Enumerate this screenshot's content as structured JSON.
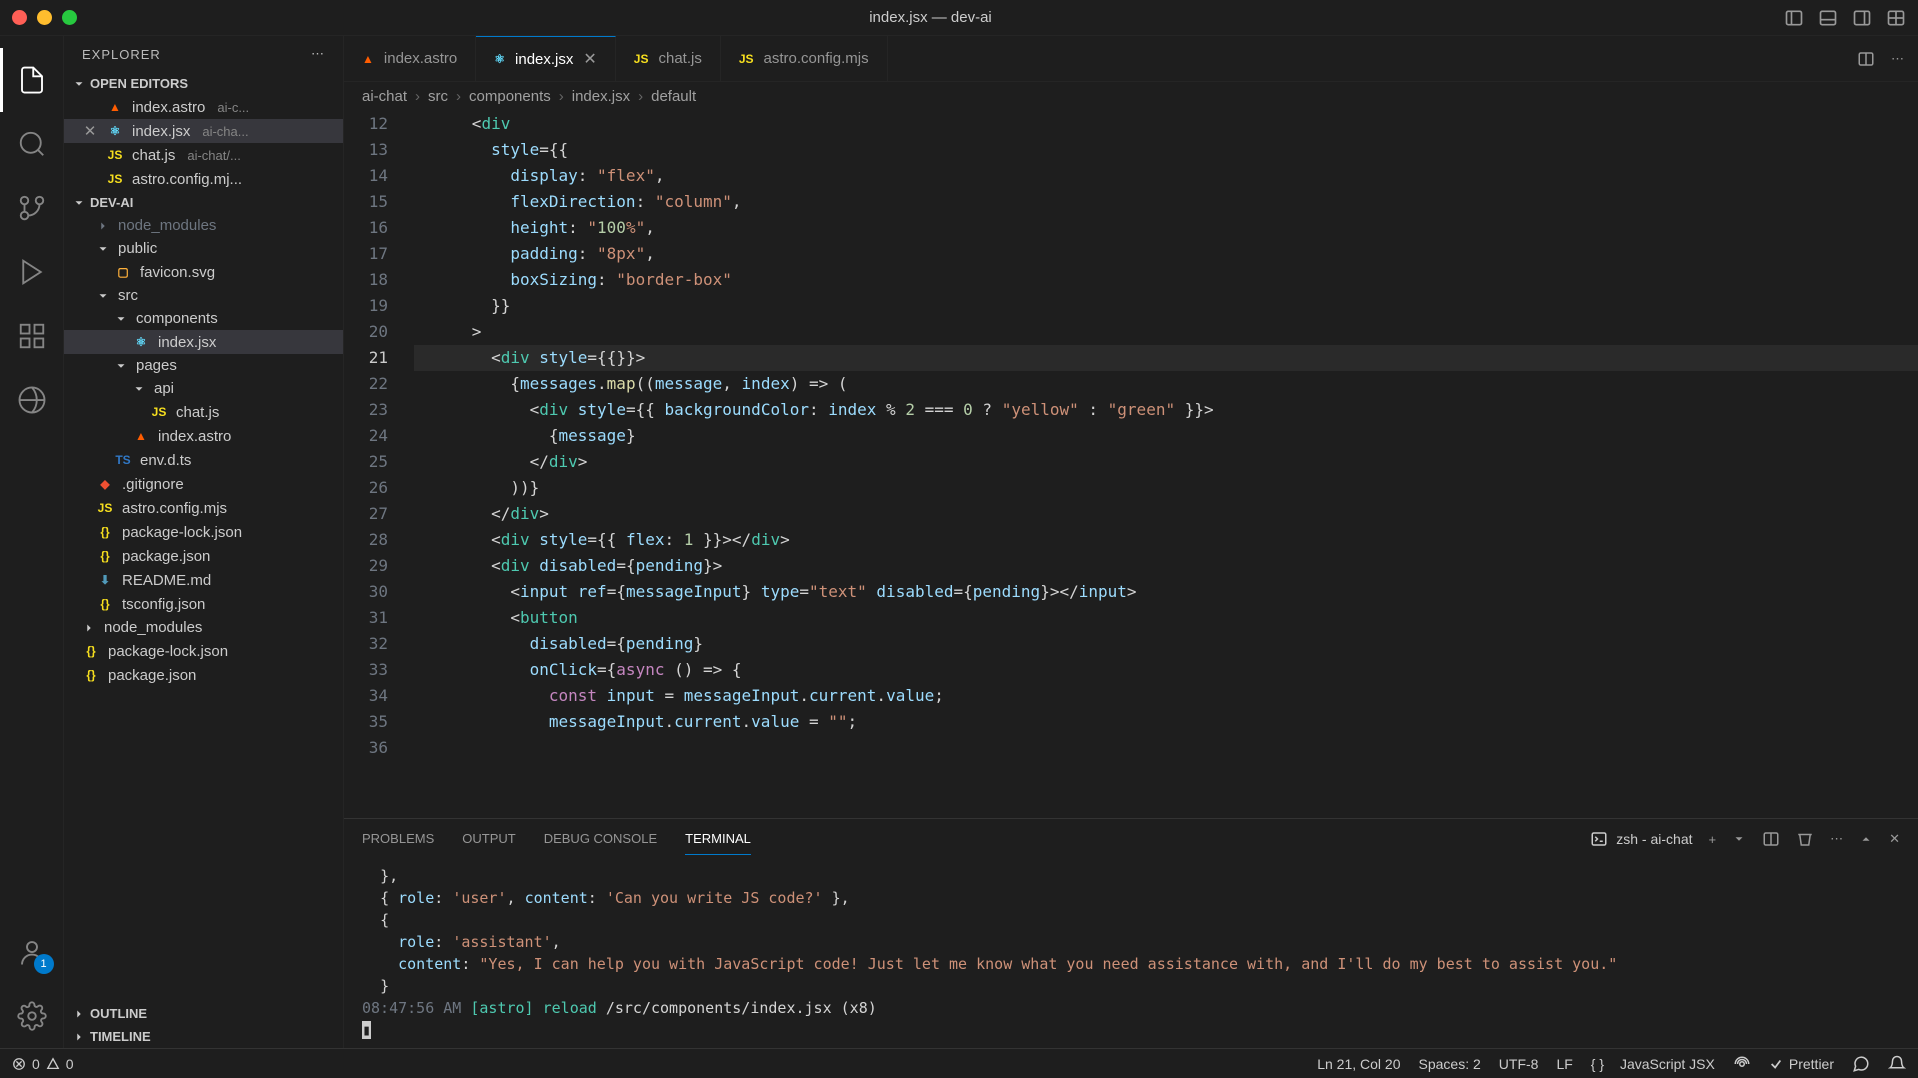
{
  "titlebar": {
    "title": "index.jsx — dev-ai"
  },
  "sidebar": {
    "title": "EXPLORER",
    "sections": {
      "openEditors": "OPEN EDITORS",
      "project": "DEV-AI",
      "outline": "OUTLINE",
      "timeline": "TIMELINE"
    },
    "openEditors": [
      {
        "name": "index.astro",
        "meta": "ai-c...",
        "close": false
      },
      {
        "name": "index.jsx",
        "meta": "ai-cha...",
        "close": true,
        "selected": true
      },
      {
        "name": "chat.js",
        "meta": "ai-chat/...",
        "close": false
      },
      {
        "name": "astro.config.mj...",
        "meta": "",
        "close": false
      }
    ],
    "tree": [
      {
        "label": "node_modules",
        "indent": 1,
        "type": "folder-dim"
      },
      {
        "label": "public",
        "indent": 1,
        "type": "folder-open"
      },
      {
        "label": "favicon.svg",
        "indent": 2,
        "type": "svg"
      },
      {
        "label": "src",
        "indent": 1,
        "type": "folder-open"
      },
      {
        "label": "components",
        "indent": 2,
        "type": "folder-open"
      },
      {
        "label": "index.jsx",
        "indent": 3,
        "type": "react",
        "selected": true
      },
      {
        "label": "pages",
        "indent": 2,
        "type": "folder-open"
      },
      {
        "label": "api",
        "indent": 3,
        "type": "folder-open"
      },
      {
        "label": "chat.js",
        "indent": 4,
        "type": "js"
      },
      {
        "label": "index.astro",
        "indent": 3,
        "type": "astro"
      },
      {
        "label": "env.d.ts",
        "indent": 2,
        "type": "ts"
      },
      {
        "label": ".gitignore",
        "indent": 1,
        "type": "git"
      },
      {
        "label": "astro.config.mjs",
        "indent": 1,
        "type": "js"
      },
      {
        "label": "package-lock.json",
        "indent": 1,
        "type": "json"
      },
      {
        "label": "package.json",
        "indent": 1,
        "type": "json"
      },
      {
        "label": "README.md",
        "indent": 1,
        "type": "md"
      },
      {
        "label": "tsconfig.json",
        "indent": 1,
        "type": "json"
      },
      {
        "label": "node_modules",
        "indent": 0,
        "type": "folder"
      },
      {
        "label": "package-lock.json",
        "indent": 0,
        "type": "json"
      },
      {
        "label": "package.json",
        "indent": 0,
        "type": "json"
      }
    ]
  },
  "tabs": [
    {
      "label": "index.astro",
      "icon": "astro",
      "active": false
    },
    {
      "label": "index.jsx",
      "icon": "react",
      "active": true,
      "close": true
    },
    {
      "label": "chat.js",
      "icon": "js",
      "active": false
    },
    {
      "label": "astro.config.mjs",
      "icon": "js",
      "active": false
    }
  ],
  "breadcrumbs": [
    "ai-chat",
    "src",
    "components",
    "index.jsx",
    "default"
  ],
  "editor": {
    "startLine": 12,
    "activeLine": 21,
    "lines": [
      "      <div",
      "        style={{",
      "          display: \"flex\",",
      "          flexDirection: \"column\",",
      "          height: \"100%\",",
      "          padding: \"8px\",",
      "          boxSizing: \"border-box\"",
      "        }}",
      "      >",
      "        <div style={{}}>",
      "          {messages.map((message, index) => (",
      "            <div style={{ backgroundColor: index % 2 === 0 ? \"yellow\" : \"green\" }}>",
      "              {message}",
      "            </div>",
      "          ))}",
      "        </div>",
      "        <div style={{ flex: 1 }}></div>",
      "        <div disabled={pending}>",
      "          <input ref={messageInput} type=\"text\" disabled={pending}></input>",
      "          <button",
      "            disabled={pending}",
      "            onClick={async () => {",
      "              const input = messageInput.current.value;",
      "              messageInput.current.value = \"\";",
      ""
    ]
  },
  "panel": {
    "tabs": [
      "PROBLEMS",
      "OUTPUT",
      "DEBUG CONSOLE",
      "TERMINAL"
    ],
    "activeTab": "TERMINAL",
    "terminalLabel": "zsh - ai-chat",
    "terminal": {
      "lines": [
        "  },",
        "  { role: 'user', content: 'Can you write JS code?' },",
        "  {",
        "    role: 'assistant',",
        "    content: \"Yes, I can help you with JavaScript code! Just let me know what you need assistance with, and I'll do my best to assist you.\"",
        "  }"
      ],
      "timestamp": "08:47:56 AM",
      "source": "[astro]",
      "action": "reload",
      "path": "/src/components/index.jsx",
      "count": "(x8)"
    }
  },
  "statusbar": {
    "errors": "0",
    "warnings": "0",
    "cursor": "Ln 21, Col 20",
    "spaces": "Spaces: 2",
    "encoding": "UTF-8",
    "eol": "LF",
    "language": "JavaScript JSX",
    "prettier": "Prettier"
  },
  "activitybar": {
    "badge": "1"
  }
}
